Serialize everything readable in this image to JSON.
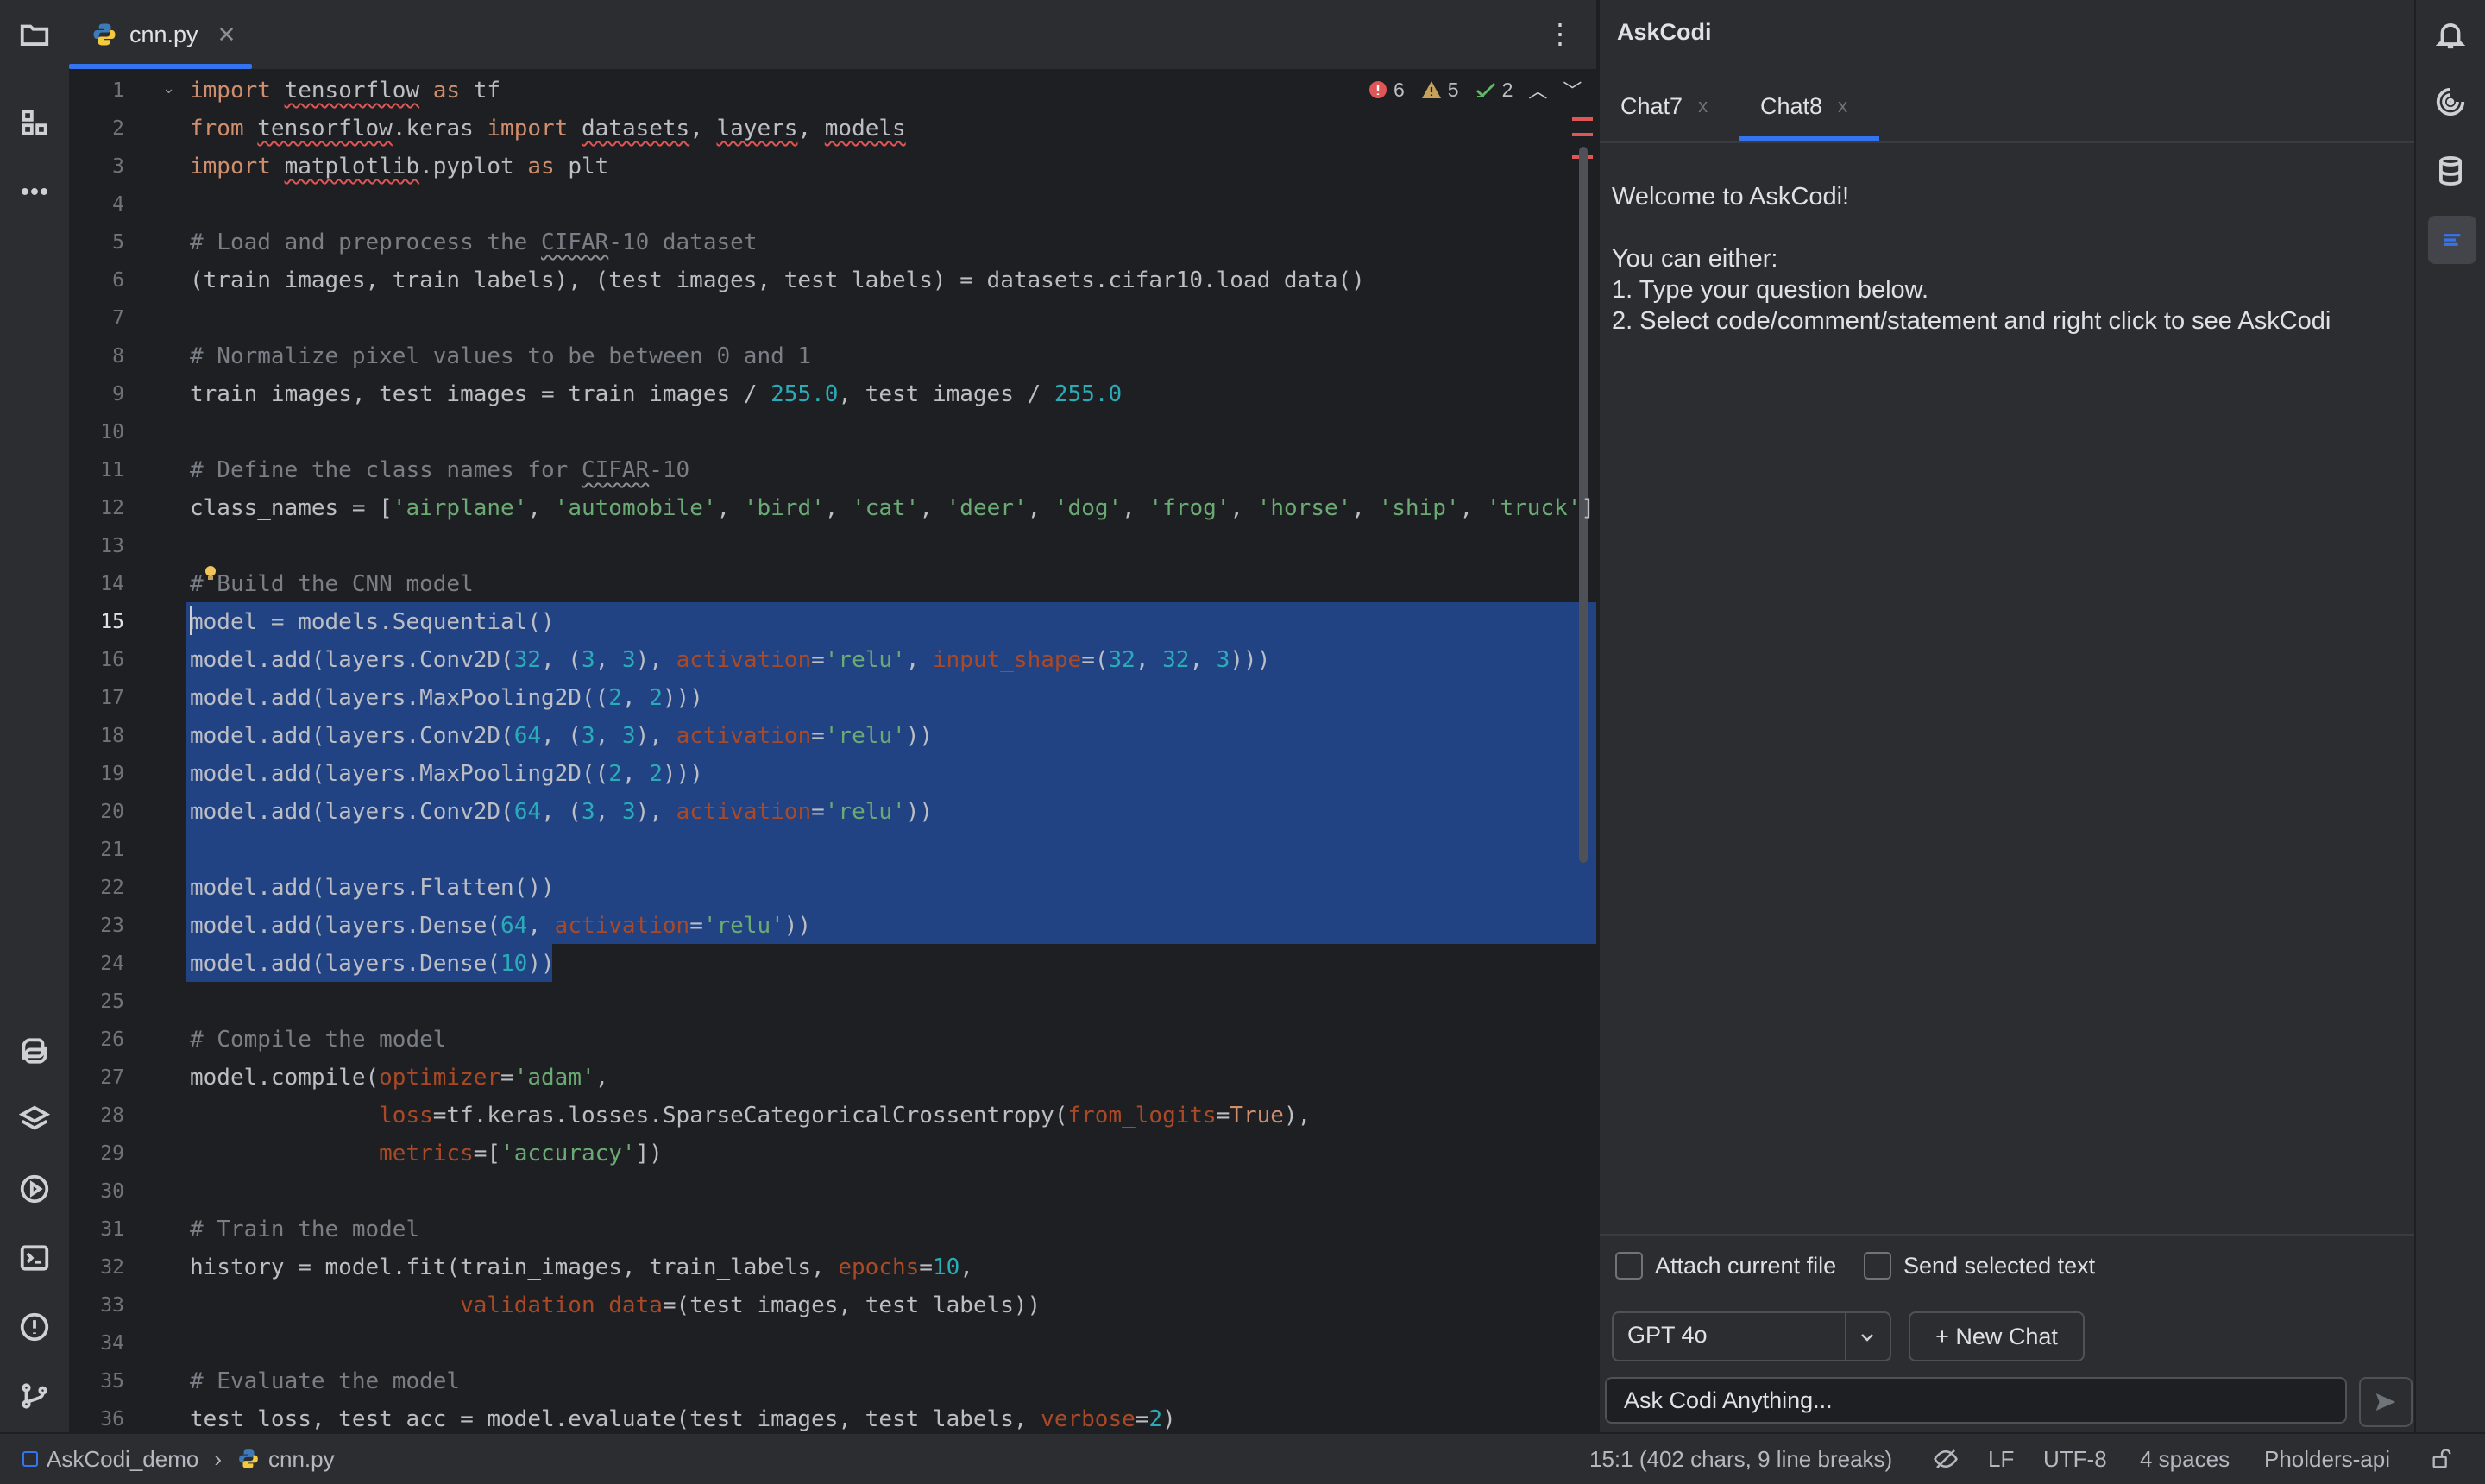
{
  "editor": {
    "tab_label": "cnn.py",
    "inspections": {
      "errors": "6",
      "warnings": "5",
      "ok": "2"
    },
    "active_line": 15
  },
  "code_lines": [
    "1",
    "2",
    "3",
    "4",
    "5",
    "6",
    "7",
    "8",
    "9",
    "10",
    "11",
    "12",
    "13",
    "14",
    "15",
    "16",
    "17",
    "18",
    "19",
    "20",
    "21",
    "22",
    "23",
    "24",
    "25",
    "26",
    "27",
    "28",
    "29",
    "30",
    "31",
    "32",
    "33",
    "34",
    "35",
    "36"
  ],
  "chat": {
    "title": "AskCodi",
    "tabs": [
      {
        "label": "Chat7",
        "close": "x"
      },
      {
        "label": "Chat8",
        "close": "x"
      }
    ],
    "active_tab": "Chat8",
    "welcome_line1": "Welcome to AskCodi!",
    "welcome_line2": "You can either:",
    "welcome_line3": "1. Type your question below.",
    "welcome_line4": "2. Select code/comment/statement and right click to see AskCodi",
    "attach_file_label": "Attach current file",
    "send_selected_label": "Send selected text",
    "model_value": "GPT 4o",
    "new_chat_label": "+ New Chat",
    "input_placeholder": "Ask Codi Anything..."
  },
  "statusbar": {
    "project": "AskCodi_demo",
    "file": "cnn.py",
    "position": "15:1 (402 chars, 9 line breaks)",
    "line_ending": "LF",
    "encoding": "UTF-8",
    "indent": "4 spaces",
    "interpreter": "Pholders-api"
  },
  "colors": {
    "accent": "#3574f0",
    "selection": "#214283",
    "error": "#e05555",
    "warning": "#c6a15b",
    "ok": "#5fb865"
  }
}
